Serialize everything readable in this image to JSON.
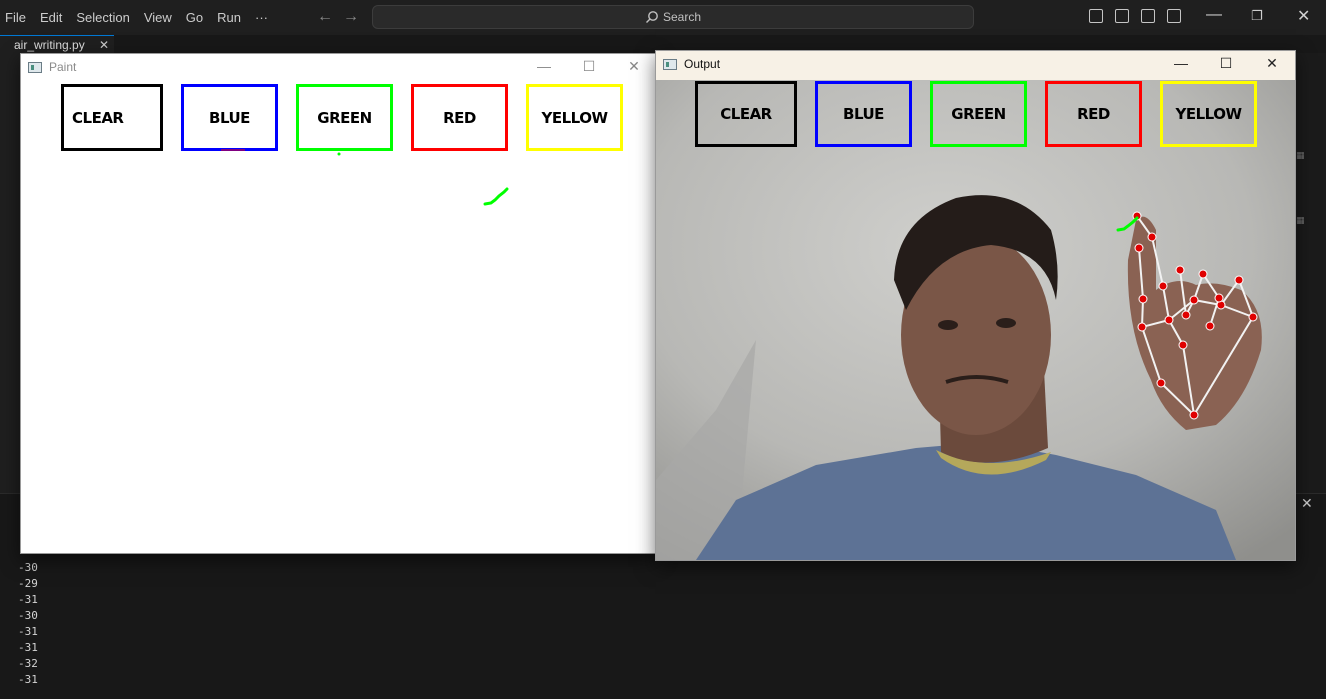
{
  "menubar": {
    "items": [
      "File",
      "Edit",
      "Selection",
      "View",
      "Go",
      "Run",
      "···"
    ],
    "search_placeholder": "Search"
  },
  "editor": {
    "tab_label": "air_writing.py",
    "terminal_lines": [
      "-30",
      "-29",
      "-31",
      "-30",
      "-31",
      "-31",
      "-32",
      "-31"
    ]
  },
  "paint_window": {
    "title": "Paint",
    "buttons": [
      {
        "label": "CLEAR",
        "color": "#000000"
      },
      {
        "label": "BLUE",
        "color": "#0000ff"
      },
      {
        "label": "GREEN",
        "color": "#00ff00"
      },
      {
        "label": "RED",
        "color": "#ff0000"
      },
      {
        "label": "YELLOW",
        "color": "#ffff00"
      }
    ]
  },
  "output_window": {
    "title": "Output",
    "buttons": [
      {
        "label": "CLEAR",
        "color": "#000000"
      },
      {
        "label": "BLUE",
        "color": "#0000ff"
      },
      {
        "label": "GREEN",
        "color": "#00ff00"
      },
      {
        "label": "RED",
        "color": "#ff0000"
      },
      {
        "label": "YELLOW",
        "color": "#ffff00"
      }
    ]
  },
  "colors": {
    "stroke_green": "#00ff00",
    "landmark_red": "#e00000",
    "hand_lines": "#f2f2f2"
  }
}
